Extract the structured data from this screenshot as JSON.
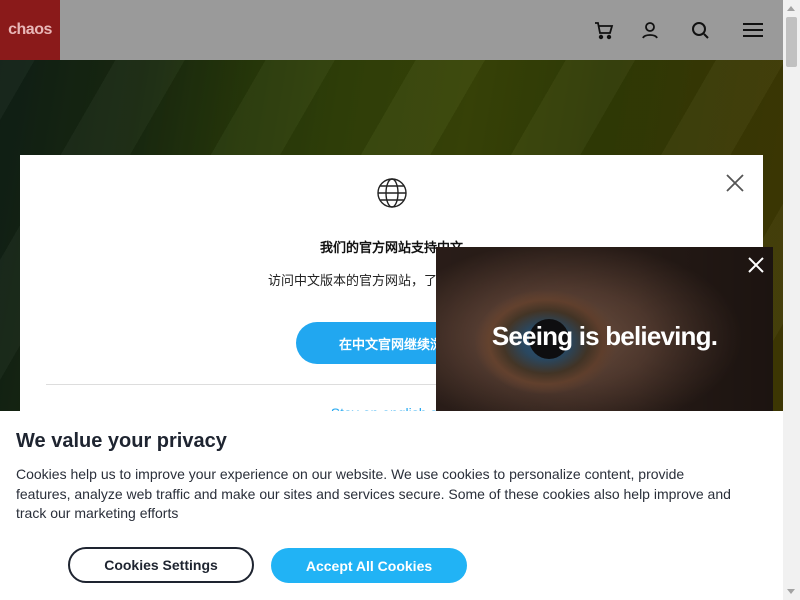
{
  "header": {
    "logo_text": "chaos",
    "icons": [
      "cart-icon",
      "user-icon",
      "search-icon",
      "menu-icon"
    ]
  },
  "language_modal": {
    "title": "我们的官方网站支持中文",
    "subtitle": "访问中文版本的官方网站，了解更多关于伱",
    "button_label": "在中文官网继续浏",
    "link_text": "Stay on english site",
    "icons": [
      "globe-icon",
      "close-icon"
    ]
  },
  "promo": {
    "text": "Seeing is believing.",
    "icons": [
      "close-icon"
    ]
  },
  "cookie_banner": {
    "title": "We value your privacy",
    "body": "Cookies help us to improve your experience on our website. We use cookies to personalize content, provide features, analyze web traffic and make our sites and services secure. Some of these cookies also help improve and track our marketing efforts",
    "settings_label": "Cookies Settings",
    "accept_label": "Accept All Cookies"
  },
  "colors": {
    "accent": "#21a7f0",
    "accept": "#21b3f5",
    "logo_bg": "#8a1a1a",
    "header_bg": "#9a9a9a",
    "dark_text": "#1e2430"
  }
}
